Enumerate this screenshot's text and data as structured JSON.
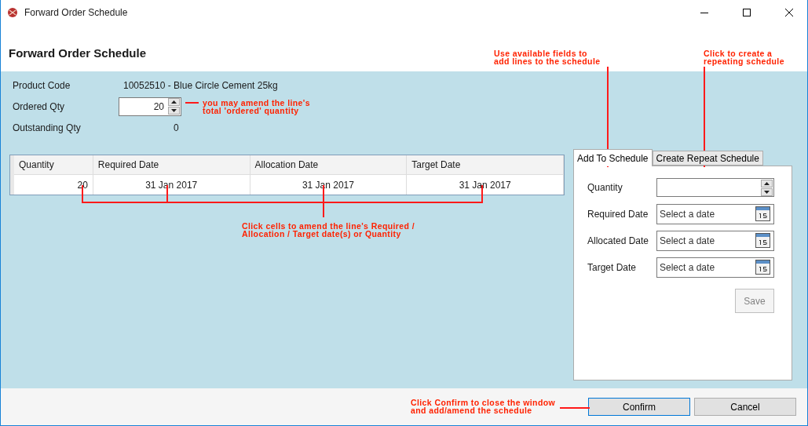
{
  "window": {
    "title": "Forward Order Schedule"
  },
  "heading": "Forward Order Schedule",
  "details": [
    {
      "kind": "text",
      "label": "Product Code",
      "value": "10052510 - Blue Circle Cement 25kg"
    },
    {
      "kind": "spinner",
      "label": "Ordered Qty",
      "value": "20"
    },
    {
      "kind": "text",
      "label": "Outstanding Qty",
      "value": "0"
    }
  ],
  "grid": {
    "columns": [
      "Quantity",
      "Required Date",
      "Allocation Date",
      "Target Date"
    ],
    "rows": [
      [
        "20",
        "31 Jan 2017",
        "31 Jan 2017",
        "31 Jan 2017"
      ]
    ]
  },
  "tabs": [
    {
      "label": "Add To Schedule",
      "selected": true
    },
    {
      "label": "Create Repeat Schedule",
      "selected": false
    }
  ],
  "tab_form": {
    "fields": [
      {
        "kind": "spinner",
        "label": "Quantity"
      },
      {
        "kind": "date",
        "label": "Required Date",
        "placeholder": "Select a date"
      },
      {
        "kind": "date",
        "label": "Allocated Date",
        "placeholder": "Select a date"
      },
      {
        "kind": "date",
        "label": "Target Date",
        "placeholder": "Select a date"
      }
    ],
    "save": {
      "label": "Save",
      "disabled": true
    }
  },
  "footer_buttons": [
    {
      "label": "Confirm",
      "focused": true
    },
    {
      "label": "Cancel",
      "focused": false
    }
  ],
  "annotations": [
    {
      "lines": [
        "you may amend the line's",
        "total 'ordered' quantity"
      ]
    },
    {
      "lines": [
        "Click cells to amend the line's Required /",
        "Allocation / Target date(s) or Quantity"
      ]
    },
    {
      "lines": [
        "Use available fields to",
        "add lines to the schedule"
      ]
    },
    {
      "lines": [
        "Click to create a",
        "repeating schedule"
      ]
    },
    {
      "lines": [
        "Click Confirm to close the window",
        "and add/amend the schedule"
      ]
    }
  ]
}
